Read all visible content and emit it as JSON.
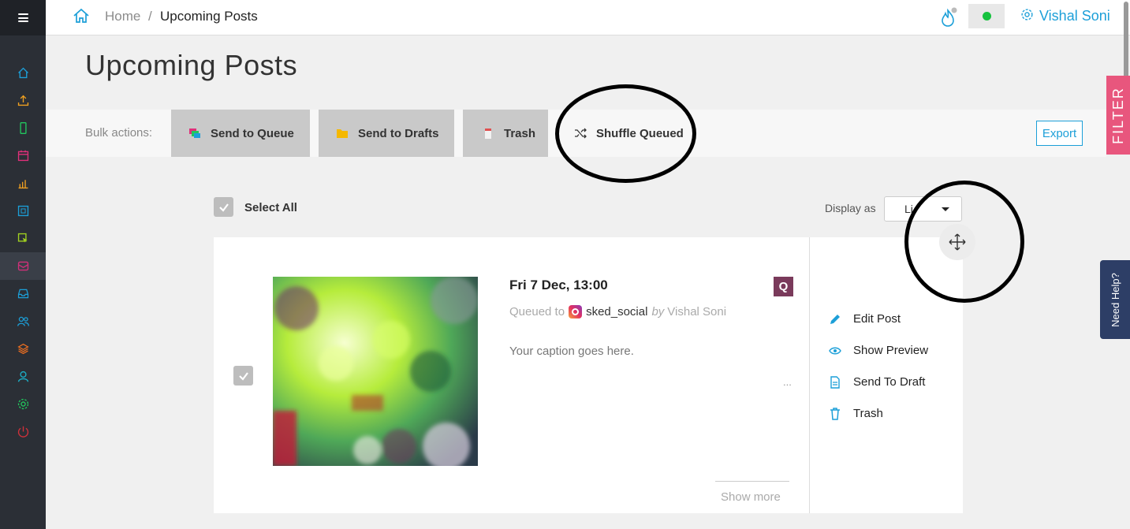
{
  "breadcrumb": {
    "home": "Home",
    "separator": "/",
    "current": "Upcoming Posts"
  },
  "user": {
    "name": "Vishal Soni",
    "status_color": "#16c23e"
  },
  "page": {
    "title": "Upcoming Posts"
  },
  "bulk": {
    "label": "Bulk actions:",
    "send_to_queue": "Send to Queue",
    "send_to_drafts": "Send to Drafts",
    "trash": "Trash",
    "shuffle": "Shuffle Queued",
    "export": "Export"
  },
  "side_tabs": {
    "filter": "FILTER",
    "help": "Need Help?"
  },
  "list_controls": {
    "select_all": "Select All",
    "display_as": "Display as",
    "display_value": "Li"
  },
  "post": {
    "date": "Fri 7 Dec, 13:00",
    "badge": "Q",
    "queued_to": "Queued to",
    "account": "sked_social",
    "by": "by",
    "author": "Vishal Soni",
    "caption": "Your caption goes here.",
    "ellipsis": "...",
    "show_more": "Show more",
    "actions": {
      "edit": "Edit Post",
      "preview": "Show Preview",
      "draft": "Send To Draft",
      "trash": "Trash"
    }
  },
  "sidebar_icons": [
    "home-icon",
    "upload-icon",
    "mobile-icon",
    "calendar-icon",
    "analytics-icon",
    "grid-icon",
    "click-icon",
    "queue-icon",
    "inbox-icon",
    "users-icon",
    "layers-icon",
    "profile-icon",
    "settings-icon",
    "power-icon"
  ],
  "colors": {
    "accent": "#1c9fd8",
    "filter": "#e8567d",
    "help": "#2d3e66",
    "sidebar": "#2b2f36",
    "badge": "#7a3a5b"
  }
}
